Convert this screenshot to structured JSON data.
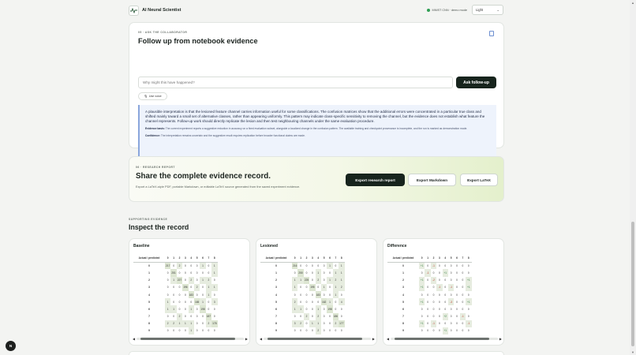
{
  "app": {
    "title": "AI Neural Scientist",
    "model_status": "MNIST CNN · demo mode",
    "theme": "Light"
  },
  "ask": {
    "eyebrow": "05 · ASK THE COLLABORATOR",
    "title": "Follow up from notebook evidence",
    "placeholder": "Why might this have happened?",
    "button": "Ask follow-up",
    "voice": "Use voice",
    "interpretation": "A plausible interpretation is that the lesioned feature channel carries information useful for some classifications. The confusion matrices show that the additional errors were concentrated in a particular true class and shifted mainly toward a small set of alternative classes, rather than appearing uniformly. This pattern may indicate class-specific sensitivity to removing the channel, but the evidence does not establish what feature the channel represents. Follow-up work should directly replicate the lesion and then test neighbouring channels under the same evaluation procedure.",
    "basis_label": "Evidence basis:",
    "basis": "The current experiment reports a suggestive reduction in accuracy on a fixed evaluation subset, alongside a localized change in the confusion pattern. The available training and checkpoint provenance is incomplete, and the run is marked as demonstration mode.",
    "confidence_label": "Confidence:",
    "confidence": "The interpretation remains uncertain and the suggestive result requires replication before broader functional claims are made."
  },
  "report": {
    "eyebrow": "06 · RESEARCH REPORT",
    "title": "Share the complete evidence record.",
    "description": "Export a LaTeX-style PDF, portable Markdown, or editable LaTeX source generated from the saved experiment evidence.",
    "btn_report": "Export research report",
    "btn_markdown": "Export Markdown",
    "btn_latex": "Export LaTeX"
  },
  "evidence": {
    "eyebrow": "SUPPORTING EVIDENCE",
    "title": "Inspect the record"
  },
  "matrices": {
    "header": "Actual / predicted",
    "cols": [
      "0",
      "1",
      "2",
      "3",
      "4",
      "5",
      "6",
      "7",
      "8"
    ],
    "baseline": {
      "title": "Baseline",
      "rows": [
        [
          "0",
          "217",
          "0",
          "2",
          "0",
          "0",
          "0",
          "1",
          "0",
          "1"
        ],
        [
          "1",
          "0",
          "251",
          "0",
          "0",
          "0",
          "0",
          "0",
          "0",
          "1"
        ],
        [
          "2",
          "0",
          "1",
          "227",
          "0",
          "2",
          "0",
          "1",
          "2",
          "0"
        ],
        [
          "3",
          "0",
          "0",
          "0",
          "196",
          "0",
          "2",
          "0",
          "1",
          "1"
        ],
        [
          "4",
          "0",
          "0",
          "0",
          "0",
          "183",
          "0",
          "0",
          "1",
          "0"
        ],
        [
          "5",
          "1",
          "0",
          "0",
          "0",
          "0",
          "165",
          "1",
          "0",
          "3"
        ],
        [
          "6",
          "1",
          "1",
          "0",
          "0",
          "1",
          "0",
          "198",
          "0",
          "0"
        ],
        [
          "7",
          "0",
          "0",
          "2",
          "0",
          "0",
          "0",
          "0",
          "187",
          "0"
        ],
        [
          "8",
          "2",
          "2",
          "1",
          "1",
          "1",
          "0",
          "0",
          "2",
          "178"
        ],
        [
          "9",
          "0",
          "0",
          "0",
          "0",
          "1",
          "0",
          "0",
          "0",
          "0"
        ]
      ]
    },
    "lesioned": {
      "title": "Lesioned",
      "rows": [
        [
          "0",
          "216",
          "0",
          "0",
          "0",
          "0",
          "0",
          "1",
          "0",
          "1"
        ],
        [
          "1",
          "0",
          "250",
          "0",
          "0",
          "1",
          "0",
          "0",
          "1",
          "1"
        ],
        [
          "2",
          "1",
          "1",
          "225",
          "0",
          "2",
          "0",
          "1",
          "2",
          "1"
        ],
        [
          "3",
          "1",
          "0",
          "0",
          "195",
          "0",
          "1",
          "0",
          "1",
          "2"
        ],
        [
          "4",
          "0",
          "0",
          "0",
          "0",
          "183",
          "0",
          "0",
          "1",
          "0"
        ],
        [
          "5",
          "2",
          "0",
          "0",
          "0",
          "0",
          "162",
          "1",
          "0",
          "4"
        ],
        [
          "6",
          "1",
          "1",
          "0",
          "0",
          "1",
          "0",
          "198",
          "0",
          "0"
        ],
        [
          "7",
          "0",
          "0",
          "2",
          "0",
          "2",
          "0",
          "0",
          "186",
          "0"
        ],
        [
          "8",
          "3",
          "2",
          "0",
          "1",
          "1",
          "0",
          "0",
          "2",
          "177"
        ],
        [
          "9",
          "0",
          "0",
          "0",
          "0",
          "2",
          "0",
          "0",
          "0",
          "0"
        ]
      ]
    },
    "difference": {
      "title": "Difference",
      "rows": [
        [
          "0",
          "+1",
          "0",
          "-1",
          "0",
          "0",
          "0",
          "0",
          "0",
          "0"
        ],
        [
          "1",
          "0",
          "-1",
          "0",
          "0",
          "+1",
          "0",
          "0",
          "0",
          "0"
        ],
        [
          "2",
          "+1",
          "0",
          "-2",
          "0",
          "0",
          "0",
          "0",
          "0",
          "+1"
        ],
        [
          "3",
          "+1",
          "0",
          "0",
          "-1",
          "0",
          "-1",
          "0",
          "0",
          "+1"
        ],
        [
          "4",
          "0",
          "0",
          "0",
          "0",
          "0",
          "0",
          "0",
          "0",
          "0"
        ],
        [
          "5",
          "+1",
          "0",
          "0",
          "0",
          "0",
          "-3",
          "0",
          "0",
          "+1"
        ],
        [
          "6",
          "0",
          "0",
          "0",
          "0",
          "0",
          "0",
          "0",
          "0",
          "0"
        ],
        [
          "7",
          "0",
          "0",
          "0",
          "0",
          "+2",
          "0",
          "0",
          "-1",
          "0"
        ],
        [
          "8",
          "+1",
          "0",
          "-1",
          "0",
          "0",
          "0",
          "0",
          "0",
          "-1"
        ],
        [
          "9",
          "0",
          "0",
          "0",
          "0",
          "+1",
          "0",
          "0",
          "0",
          "0"
        ]
      ]
    }
  },
  "fab": "N"
}
